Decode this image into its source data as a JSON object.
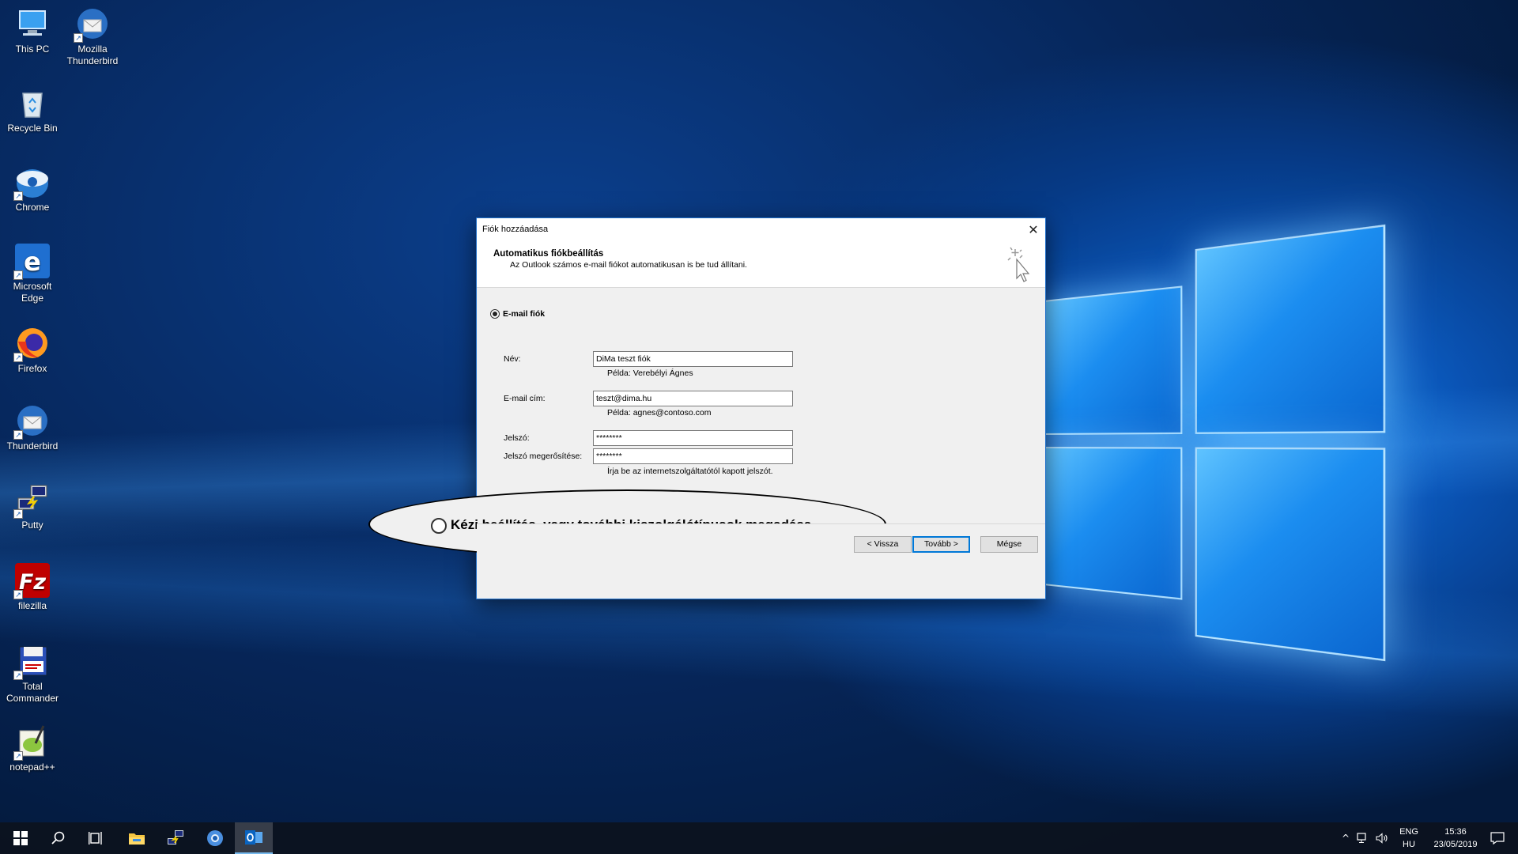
{
  "desktop": {
    "icons": [
      {
        "name": "this-pc",
        "label": "This PC"
      },
      {
        "name": "mozilla-thunderbird",
        "label": "Mozilla Thunderbird"
      },
      {
        "name": "recycle-bin",
        "label": "Recycle Bin"
      },
      {
        "name": "chrome",
        "label": "Chrome"
      },
      {
        "name": "microsoft-edge",
        "label": "Microsoft Edge"
      },
      {
        "name": "firefox",
        "label": "Firefox"
      },
      {
        "name": "thunderbird",
        "label": "Thunderbird"
      },
      {
        "name": "putty",
        "label": "Putty"
      },
      {
        "name": "filezilla",
        "label": "filezilla"
      },
      {
        "name": "total-commander",
        "label": "Total Commander"
      },
      {
        "name": "notepad-plus-plus",
        "label": "notepad++"
      }
    ]
  },
  "dialog": {
    "title": "Fiók hozzáadása",
    "close_glyph": "✕",
    "header": {
      "heading": "Automatikus fiókbeállítás",
      "subheading": "Az Outlook számos e-mail fiókot automatikusan is be tud állítani."
    },
    "email_account_option": "E-mail fiók",
    "fields": {
      "name": {
        "label": "Név:",
        "value": "DiMa teszt fiók",
        "hint": "Példa: Verebélyi Ágnes"
      },
      "email": {
        "label": "E-mail cím:",
        "value": "teszt@dima.hu",
        "hint": "Példa: agnes@contoso.com"
      },
      "password": {
        "label": "Jelszó:",
        "value": "********"
      },
      "password_confirm": {
        "label": "Jelszó megerősítése:",
        "value": "********"
      },
      "password_hint": "Írja be az internetszolgáltatótól kapott jelszót."
    },
    "manual_option": "Kézi beállítás, vagy további kiszolgálótípusok megadása",
    "buttons": {
      "back": "< Vissza",
      "next": "Tovább >",
      "cancel": "Mégse"
    }
  },
  "taskbar": {
    "language": "ENG",
    "locale": "HU",
    "time": "15:36",
    "date": "23/05/2019"
  },
  "colors": {
    "accent": "#0078d7",
    "taskbar": "#0c121e"
  }
}
